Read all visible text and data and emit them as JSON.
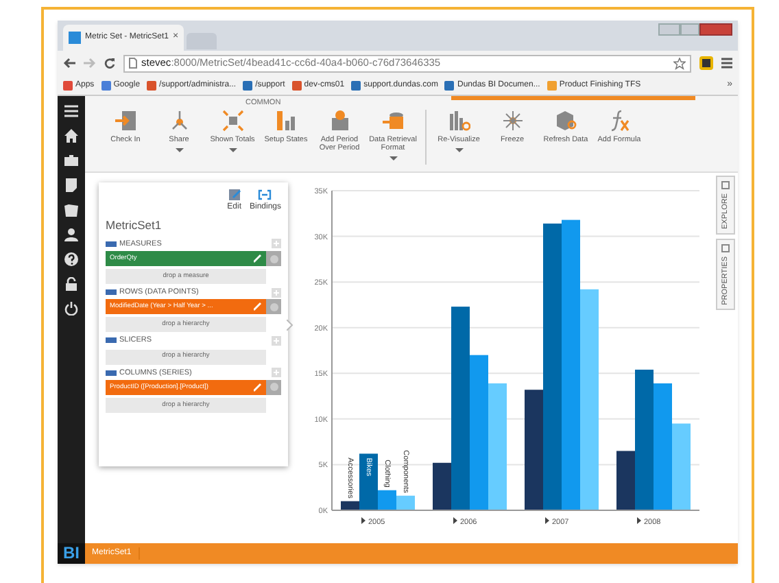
{
  "browser": {
    "tab_title": "Metric Set - MetricSet1",
    "tab_close": "×",
    "url_host": "stevec",
    "url_rest": ":8000/MetricSet/4bead41c-cc6d-40a4-b060-c76d73646335",
    "bookmarks": [
      {
        "label": "Apps",
        "color": "#e04a3a"
      },
      {
        "label": "Google",
        "color": "#4a7fd8"
      },
      {
        "label": "/support/administra...",
        "color": "#d9532c"
      },
      {
        "label": "/support",
        "color": "#2a6fb5"
      },
      {
        "label": "dev-cms01",
        "color": "#d9532c"
      },
      {
        "label": "support.dundas.com",
        "color": "#2a6fb5"
      },
      {
        "label": "Dundas BI Documen...",
        "color": "#2a6fb5"
      },
      {
        "label": "Product Finishing TFS",
        "color": "#f0a030"
      }
    ],
    "more": "»"
  },
  "ribbon": {
    "group": "COMMON",
    "items": [
      {
        "kind": "button",
        "label": "Check In",
        "dropdown": false
      },
      {
        "kind": "button",
        "label": "Share",
        "dropdown": true
      },
      {
        "kind": "button",
        "label": "Shown Totals",
        "dropdown": true
      },
      {
        "kind": "button",
        "label": "Setup States",
        "dropdown": false
      },
      {
        "kind": "button",
        "label": "Add Period Over Period",
        "dropdown": false
      },
      {
        "kind": "button",
        "label": "Data Retrieval Format",
        "dropdown": true
      },
      {
        "kind": "separator"
      },
      {
        "kind": "button",
        "label": "Re-Visualize",
        "dropdown": true
      },
      {
        "kind": "button",
        "label": "Freeze",
        "dropdown": false
      },
      {
        "kind": "button",
        "label": "Refresh Data",
        "dropdown": false
      },
      {
        "kind": "button",
        "label": "Add Formula",
        "dropdown": false
      }
    ]
  },
  "panel": {
    "edit": "Edit",
    "bindings": "Bindings",
    "title": "MetricSet1",
    "sections": [
      {
        "title": "MEASURES",
        "items": [
          {
            "label": "OrderQty",
            "color": "#2e8b47"
          }
        ],
        "drop": "drop a measure"
      },
      {
        "title": "ROWS (DATA POINTS)",
        "items": [
          {
            "label": "ModifiedDate (Year > Half Year > ...",
            "color": "#f26b0f"
          }
        ],
        "drop": "drop a hierarchy"
      },
      {
        "title": "SLICERS",
        "drop": "drop a hierarchy"
      },
      {
        "title": "COLUMNS (SERIES)",
        "items": [
          {
            "label": "ProductID ([Production].[Product])",
            "color": "#f26b0f"
          }
        ],
        "drop": "drop a hierarchy"
      }
    ]
  },
  "side_tabs": [
    "EXPLORE",
    "PROPERTIES"
  ],
  "chart": {
    "chart_data": {
      "type": "bar",
      "grid": true,
      "categories": [
        "2005",
        "2006",
        "2007",
        "2008"
      ],
      "ylim": [
        0,
        35000
      ],
      "yticks": [
        {
          "value": 0,
          "label": "0K"
        },
        {
          "value": 5000,
          "label": "5K"
        },
        {
          "value": 10000,
          "label": "10K"
        },
        {
          "value": 15000,
          "label": "15K"
        },
        {
          "value": 20000,
          "label": "20K"
        },
        {
          "value": 25000,
          "label": "25K"
        },
        {
          "value": 30000,
          "label": "30K"
        },
        {
          "value": 35000,
          "label": "35K"
        }
      ],
      "series": [
        {
          "name": "Accessories",
          "color": "#1b365f",
          "values": [
            1000,
            5200,
            13200,
            6500
          ]
        },
        {
          "name": "Bikes",
          "color": "#0069a8",
          "values": [
            6200,
            22300,
            31400,
            15400
          ]
        },
        {
          "name": "Clothing",
          "color": "#1199ee",
          "values": [
            2200,
            17000,
            31800,
            13900
          ]
        },
        {
          "name": "Components",
          "color": "#66ccff",
          "values": [
            1600,
            13900,
            24200,
            9500
          ]
        }
      ]
    }
  },
  "footer": {
    "logo": "BI",
    "title": "MetricSet1"
  }
}
